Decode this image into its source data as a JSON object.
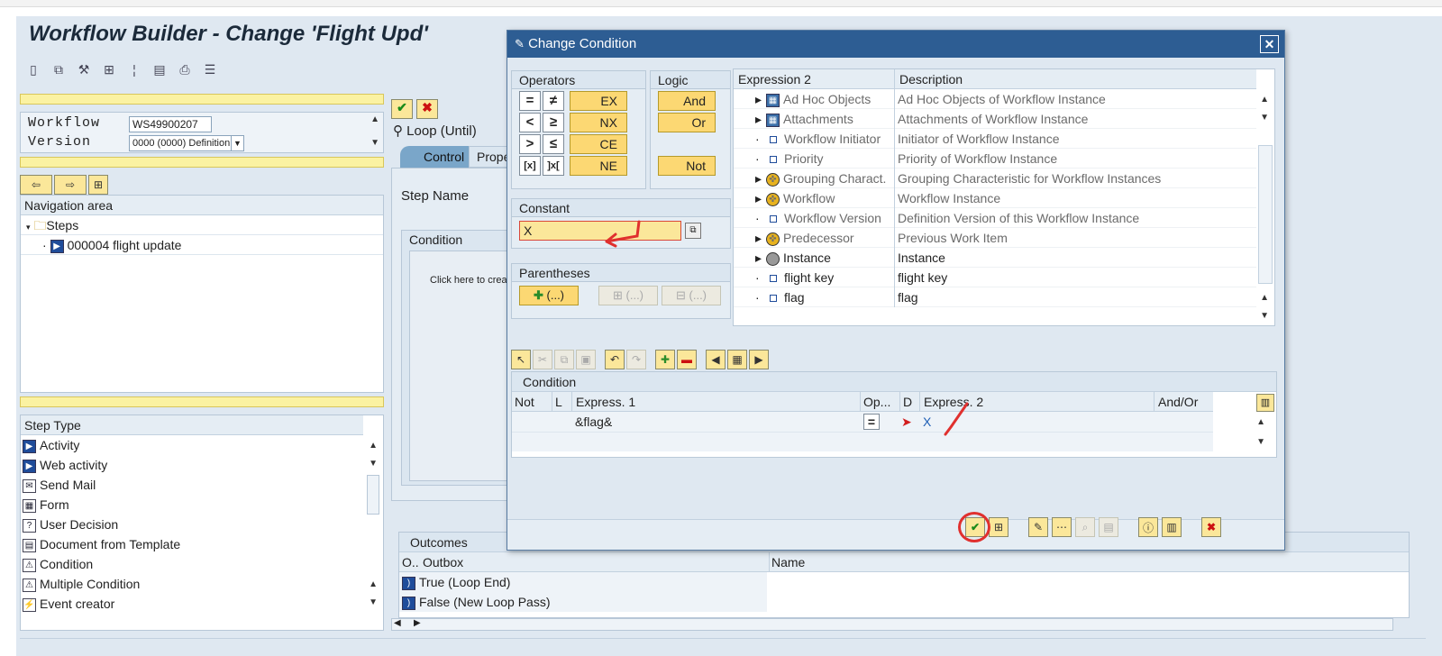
{
  "window": {
    "title": "Workflow Builder - Change 'Flight Upd'"
  },
  "left_panel": {
    "workflow_label": "Workflow",
    "workflow_value": "WS49900207",
    "version_label": "Version",
    "version_value": "0000 (0000) Definition",
    "nav_header": "Navigation area",
    "tree": [
      {
        "label": "Steps"
      },
      {
        "label": "000004 flight update"
      }
    ],
    "step_type_header": "Step Type",
    "step_types": [
      "Activity",
      "Web activity",
      "Send Mail",
      "Form",
      "User Decision",
      "Document from Template",
      "Condition",
      "Multiple Condition",
      "Event creator"
    ]
  },
  "center_panel": {
    "loop_label": "Loop (Until)",
    "tabs": [
      "Control",
      "Prope"
    ],
    "step_name_label": "Step Name",
    "condition_label": "Condition",
    "click_here": "Click here to crea",
    "outcomes_header": "Outcomes",
    "outcomes_cols": [
      "O..",
      "Outbox",
      "Name"
    ],
    "outcomes_rows": [
      "True (Loop End)",
      "False (New Loop Pass)"
    ]
  },
  "dialog": {
    "title": "Change Condition",
    "operators": {
      "header": "Operators",
      "symbols": [
        "=",
        "≠",
        "<",
        "≥",
        ">",
        "≤",
        "[x]",
        "]x["
      ],
      "words": [
        "EX",
        "NX",
        "CE",
        "NE"
      ]
    },
    "logic": {
      "header": "Logic",
      "and": "And",
      "or": "Or",
      "not": "Not"
    },
    "constant": {
      "header": "Constant",
      "value": "X"
    },
    "parentheses": {
      "header": "Parentheses",
      "btn": "(...)"
    },
    "expression_table": {
      "columns": [
        "Expression 2",
        "Description"
      ],
      "rows": [
        {
          "name": "Ad Hoc Objects",
          "desc": "Ad Hoc Objects of Workflow Instance",
          "icon": "grid-icon"
        },
        {
          "name": "Attachments",
          "desc": "Attachments of Workflow Instance",
          "icon": "grid-icon"
        },
        {
          "name": "Workflow Initiator",
          "desc": "Initiator of Workflow Instance",
          "icon": "square-icon"
        },
        {
          "name": "Priority",
          "desc": "Priority of Workflow Instance",
          "icon": "square-icon"
        },
        {
          "name": "Grouping Charact.",
          "desc": "Grouping Characteristic for Workflow Instances",
          "icon": "object-icon"
        },
        {
          "name": "Workflow",
          "desc": "Workflow Instance",
          "icon": "object-icon"
        },
        {
          "name": "Workflow Version",
          "desc": "Definition Version of this Workflow Instance",
          "icon": "square-icon"
        },
        {
          "name": "Predecessor",
          "desc": "Previous Work Item",
          "icon": "object-icon"
        },
        {
          "name": "Instance",
          "desc": "Instance",
          "icon": "instance-icon"
        },
        {
          "name": "flight key",
          "desc": "flight key",
          "icon": "square-icon"
        },
        {
          "name": "flag",
          "desc": "flag",
          "icon": "square-icon"
        }
      ]
    },
    "condition_table": {
      "header": "Condition",
      "columns": [
        "Not",
        "L",
        "Express. 1",
        "Op...",
        "D",
        "Express. 2",
        "And/Or"
      ],
      "row": {
        "expr1": "&flag&",
        "op": "=",
        "expr2": "X"
      }
    }
  }
}
